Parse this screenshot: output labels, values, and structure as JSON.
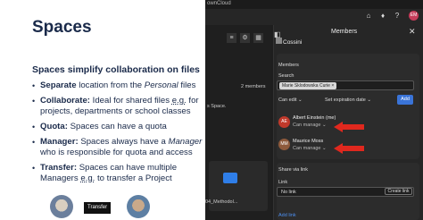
{
  "slide": {
    "title": "Spaces",
    "subtitle": "Spaces simplify collaboration on files",
    "bullets": [
      {
        "bold": "Separate",
        "pre": " location from the ",
        "ital": "Personal",
        "post": " files"
      },
      {
        "bold": "Collaborate:",
        "pre": " Ideal for shared files ",
        "ital": "",
        "under": "e.g.",
        "post": " for projects, departments or school classes"
      },
      {
        "bold": "Quota:",
        "pre": " Spaces can have a quota",
        "ital": "",
        "post": ""
      },
      {
        "bold": "Manager:",
        "pre": " Spaces always have a ",
        "ital": "Manager",
        "post": " who is responsible for quota and access"
      },
      {
        "bold": "Transfer:",
        "pre": " Spaces can have multiple Managers ",
        "ital": "",
        "under": "e.g.",
        "post": " to transfer a Project"
      }
    ],
    "transfer_label": "Transfer"
  },
  "app": {
    "window_title": "ownCloud",
    "files": {
      "members_count": "2 members",
      "spaces_text": "s Space.",
      "file_name": "04_Methodol..."
    },
    "sidebar": {
      "title": "Members",
      "space_name": "Cossini",
      "members_label": "Members",
      "search_label": "Search",
      "search_chip": "Marie Sklodowska Curie",
      "chip_close": "×",
      "can_edit": "Can edit",
      "expiration": "Set expiration date",
      "add_button": "Add",
      "members": [
        {
          "initials": "AE",
          "name": "Albert Einstein (me)",
          "role": "Can manage",
          "color": "#c0392b"
        },
        {
          "initials": "MM",
          "name": "Maurice Moss",
          "role": "Can manage",
          "color": "#8e5a3c"
        }
      ],
      "link_title": "Share via link",
      "link_label": "Link",
      "link_value": "No link",
      "create_link": "Create link",
      "add_link": "Add link"
    },
    "header": {
      "avatar": "EM",
      "avatar_color": "#c53c5a"
    },
    "accent_color": "#3a74d8",
    "arrow_color": "#e0281e"
  }
}
